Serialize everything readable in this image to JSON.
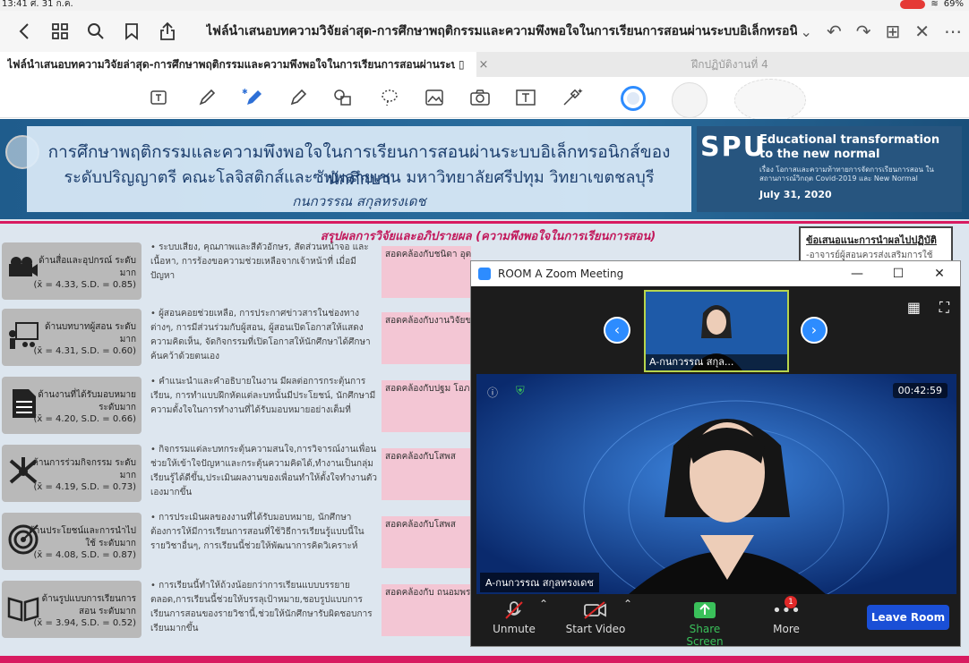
{
  "status_bar": {
    "time": "13:41",
    "date": "ศ. 31 ก.ค.",
    "battery": "69%"
  },
  "browser": {
    "title": "ไฟล์นำเสนอบทความวิจัยล่าสุด-การศึกษาพฤติกรรมและความพึงพอใจในการเรียนการสอนผ่านระบบอิเล็กทรอนิกส์ของนักศึ...",
    "tabs": [
      {
        "label": "ไฟล์นำเสนอบทความวิจัยล่าสุด-การศึกษาพฤติกรรมและความพึงพอใจในการเรียนการสอนผ่านระบบอิ..."
      },
      {
        "label": "ฝึกปฏิบัติงานที่ 4"
      }
    ]
  },
  "slide": {
    "title_line1": "การศึกษาพฤติกรรมและความพึงพอใจในการเรียนการสอนผ่านระบบอิเล็กทรอนิกส์ของนักศึกษา",
    "title_line2": "ระดับปริญญาตรี คณะโลจิสติกส์และซัพพลายเชน มหาวิทยาลัยศรีปทุม วิทยาเขตชลบุรี",
    "author": "กนกวรรณ สกุลทรงเดช",
    "spu_logo": "SPU",
    "spu_tagline": "Educational transformation to the new normal",
    "spu_subtitle": "เรื่อง โอกาสและความท้าทายการจัดการเรียนการสอน ในสถานการณ์วิกฤต Covid-2019 และ New Normal",
    "spu_date": "July 31, 2020",
    "summary_title": "สรุปผลการวิจัยและอภิปรายผล (ความพึงพอใจในการเรียนการสอน)",
    "recommend_title": "ข้อเสนอแนะการนำผลไปปฏิบัติ",
    "recommend_text": "-อาจารย์ผู้สอนควรส่งเสริมการใช้",
    "rows": [
      {
        "label": "ด้านสื่อและอุปกรณ์ ระดับมาก",
        "stats": "(x̄ = 4.33, S.D. = 0.85)",
        "desc": "• ระบบเสียง, คุณภาพและสีตัวอักษร, สัดส่วนหน้าจอ และเนื้อหา, การร้องขอความช่วยเหลือจากเจ้าหน้าที่ เมื่อมีปัญหา",
        "pink": "สอดคล้องกับชนิดา อุตมสิทธิ์พัฒนา"
      },
      {
        "label": "ด้านบทบาทผู้สอน ระดับมาก",
        "stats": "(x̄ = 4.31, S.D. = 0.60)",
        "desc": "• ผู้สอนคอยช่วยเหลือ, การประกาศข่าวสารในช่องทางต่างๆ, การมีส่วนร่วมกับผู้สอน, ผู้สอนเปิดโอกาสให้แสดงความคิดเห็น, จัดกิจกรรมที่เปิดโอกาสให้นักศึกษาได้ศึกษาค้นคว้าด้วยตนเอง",
        "pink": "สอดคล้องกับงานวิจัยของ"
      },
      {
        "label": "ด้านงานที่ได้รับมอบหมาย ระดับมาก",
        "stats": "(x̄ = 4.20, S.D. = 0.66)",
        "desc": "• คำแนะนำและคำอธิบายในงาน มีผลต่อการกระตุ้นการเรียน, การทำแบบฝึกหัดแต่ละบทนั้นมีประโยชน์, นักศึกษามีความตั้งใจในการทำงานที่ได้รับมอบหมายอย่างเต็มที่",
        "pink": "สอดคล้องกับปฐม โอภ"
      },
      {
        "label": "ด้านการร่วมกิจกรรม ระดับมาก",
        "stats": "(x̄ = 4.19, S.D. = 0.73)",
        "desc": "• กิจกรรมแต่ละบทกระตุ้นความสนใจ,การวิจารณ์งานเพื่อนช่วยให้เข้าใจปัญหาและกระตุ้นความคิดได้,ทำงานเป็นกลุ่มเรียนรู้ได้ดีขึ้น,ประเมินผลงานของเพื่อนทำให้ตั้งใจทำงานตัวเองมากขึ้น",
        "pink": "สอดคล้องกับโสพส"
      },
      {
        "label": "ด้านประโยชน์และการนำไปใช้ ระดับมาก",
        "stats": "(x̄ = 4.08, S.D. = 0.87)",
        "desc": "• การประเมินผลของงานที่ได้รับมอบหมาย, นักศึกษาต้องการให้มีการเรียนการสอนที่ใช้วิธีการเรียนรู้แบบนี้ในรายวิชาอื่นๆ, การเรียนนี้ช่วยให้พัฒนาการคิดวิเคราะห์",
        "pink": "สอดคล้องกับโสพส"
      },
      {
        "label": "ด้านรูปแบบการเรียนการสอน ระดับมาก",
        "stats": "(x̄ = 3.94, S.D. = 0.52)",
        "desc": "• การเรียนนี้ทำให้ถ้วงน้อยกว่าการเรียนแบบบรรยายตลอด,การเรียนนี้ช่วยให้บรรลุเป้าหมาย,ชอบรูปแบบการเรียนการสอนของรายวิชานี้,ช่วยให้นักศึกษารับผิดชอบการเรียนมากขึ้น",
        "pink": "สอดคล้องกับ ถนอมพร"
      }
    ]
  },
  "zoom": {
    "window_title": "ROOM A   Zoom Meeting",
    "participant_name": "A-กนกวรรณ สกุล...",
    "video_name": "A-กนกวรรณ สกุลทรงเดช",
    "timer": "00:42:59",
    "unmute_label": "Unmute",
    "start_video_label": "Start Video",
    "share_screen_label": "Share Screen",
    "more_label": "More",
    "more_badge": "1",
    "leave_label": "Leave Room"
  }
}
